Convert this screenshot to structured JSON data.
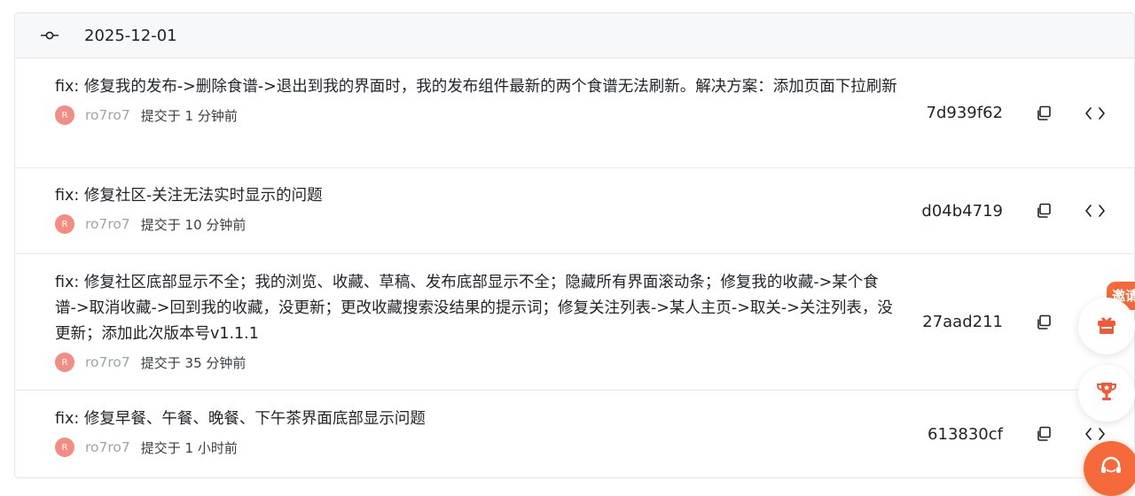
{
  "group": {
    "date": "2025-12-01",
    "icon": "git-commit-icon"
  },
  "commits": [
    {
      "message": "fix: 修复我的发布->删除食谱->退出到我的界面时，我的发布组件最新的两个食谱无法刷新。解决方案：添加页面下拉刷新",
      "avatar_letter": "R",
      "author": "ro7ro7",
      "time": "提交于 1 分钟前",
      "sha": "7d939f62"
    },
    {
      "message": "fix: 修复社区-关注无法实时显示的问题",
      "avatar_letter": "R",
      "author": "ro7ro7",
      "time": "提交于 10 分钟前",
      "sha": "d04b4719"
    },
    {
      "message": "fix: 修复社区底部显示不全；我的浏览、收藏、草稿、发布底部显示不全；隐藏所有界面滚动条；修复我的收藏->某个食谱->取消收藏->回到我的收藏，没更新；更改收藏搜索没结果的提示词；修复关注列表->某人主页->取关->关注列表，没更新；添加此次版本号v1.1.1",
      "avatar_letter": "R",
      "author": "ro7ro7",
      "time": "提交于 35 分钟前",
      "sha": "27aad211"
    },
    {
      "message": "fix: 修复早餐、午餐、晚餐、下午茶界面底部显示问题",
      "avatar_letter": "R",
      "author": "ro7ro7",
      "time": "提交于 1 小时前",
      "sha": "613830cf"
    }
  ],
  "float": {
    "invite_label": "邀请",
    "gift_icon": "gift-icon",
    "trophy_icon": "trophy-icon",
    "support_icon": "customer-service-icon"
  },
  "colors": {
    "border": "#e5e6eb",
    "header_bg": "#f7f8fa",
    "avatar": "#f18d83",
    "accent": "#f5693a"
  }
}
